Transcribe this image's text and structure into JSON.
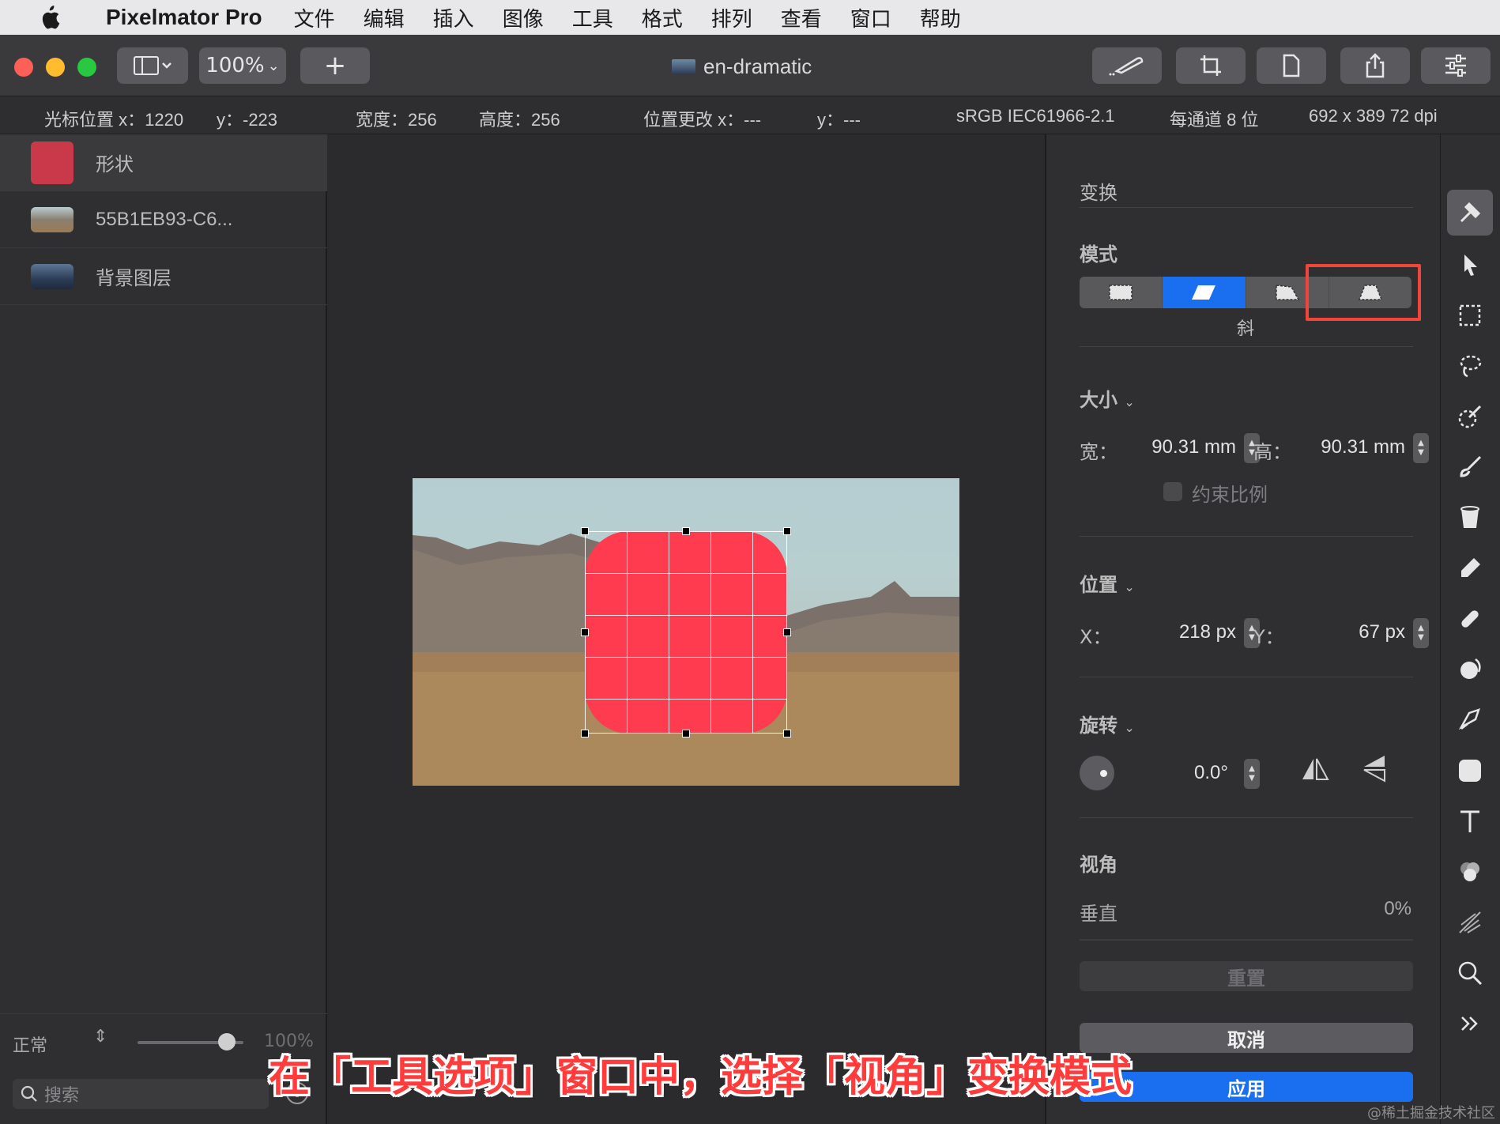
{
  "menubar": {
    "app_name": "Pixelmator Pro",
    "items": [
      "文件",
      "编辑",
      "插入",
      "图像",
      "工具",
      "格式",
      "排列",
      "查看",
      "窗口",
      "帮助"
    ]
  },
  "toolbar": {
    "zoom": "100%",
    "add_label": "+",
    "document_title": "en-dramatic"
  },
  "infobar": {
    "cursor_x": "光标位置 x：1220",
    "cursor_y": "y：-223",
    "width": "宽度：256",
    "height": "高度：256",
    "pos_change_x": "位置更改 x：---",
    "pos_change_y": "y：---",
    "color_profile": "sRGB IEC61966-2.1",
    "bit_depth": "每通道 8 位",
    "image_size": "692 x 389 72 dpi"
  },
  "layers": {
    "items": [
      {
        "label": "形状",
        "color": "#c9394a"
      },
      {
        "label": "55B1EB93-C6...",
        "color": "#9a8a70"
      },
      {
        "label": "背景图层",
        "color": "#3a4e6e"
      }
    ],
    "blend_mode": "正常",
    "opacity": "100%",
    "opacity_fraction": 0.84,
    "search_placeholder": "搜索"
  },
  "inspector": {
    "section_title": "变换",
    "mode_label": "模式",
    "mode_caption": "斜",
    "size_label": "大小",
    "width_label": "宽：",
    "width_value": "90.31 mm",
    "height_label": "高：",
    "height_value": "90.31 mm",
    "constrain_label": "约束比例",
    "position_label": "位置",
    "x_label": "X：",
    "x_value": "218 px",
    "y_label": "Y：",
    "y_value": "67 px",
    "rotate_label": "旋转",
    "rotate_value": "0.0°",
    "perspective_label": "视角",
    "vertical_label": "垂直",
    "vertical_value": "0%",
    "reset_label": "重置",
    "cancel_label": "取消",
    "apply_label": "应用"
  },
  "colors": {
    "accent": "#1a6ff0",
    "shape_fill": "#ff3b4f",
    "highlight": "#f0453a"
  },
  "caption": "在「工具选项」窗口中，选择「视角」变换模式",
  "watermark": "@稀土掘金技术社区"
}
